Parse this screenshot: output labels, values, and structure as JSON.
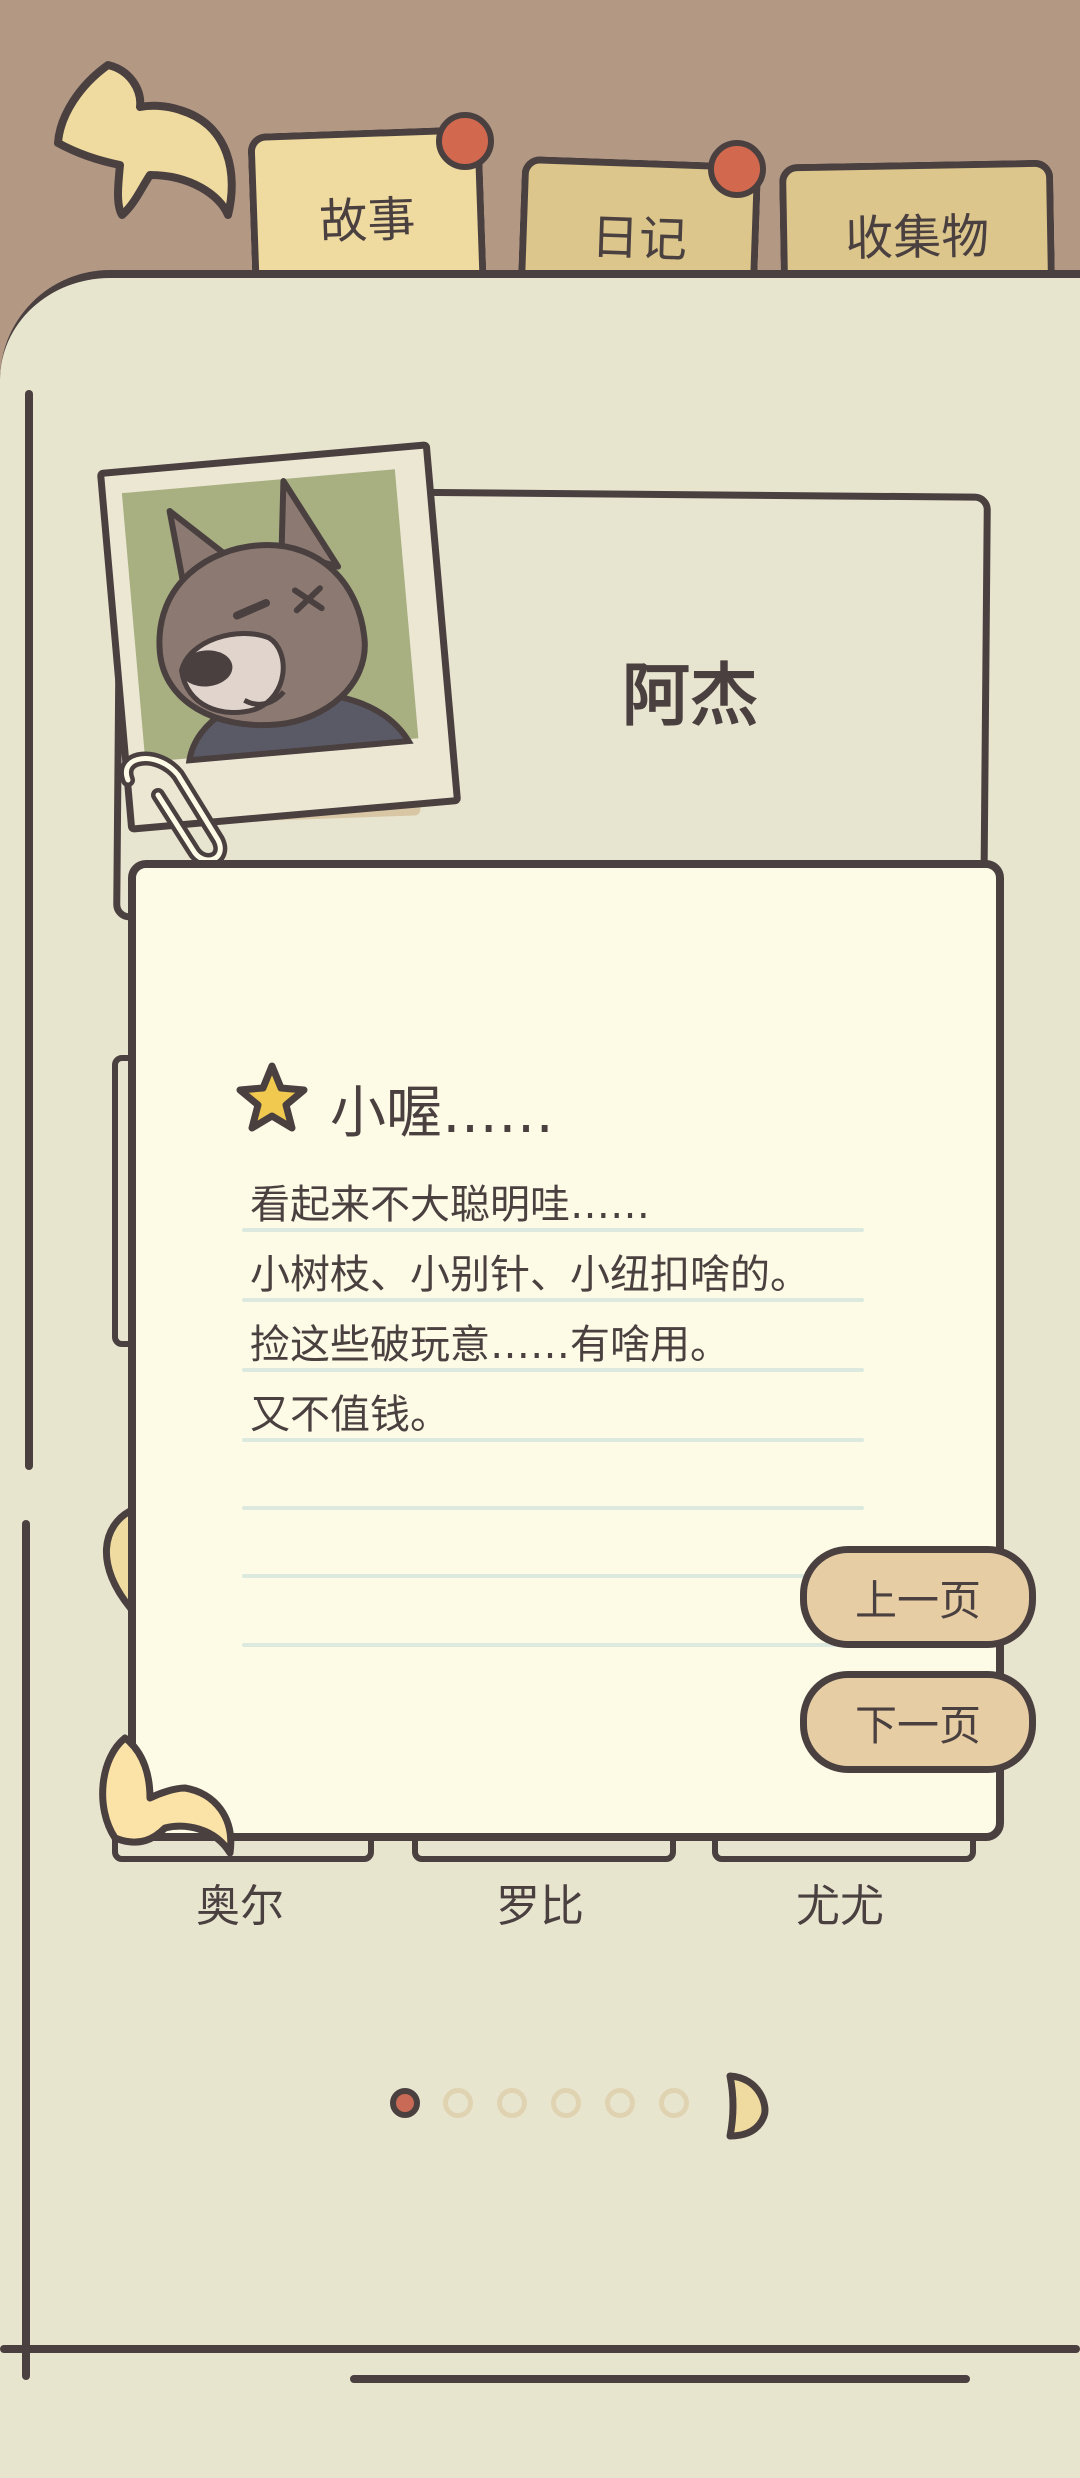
{
  "tabs": [
    {
      "label": "故事",
      "active": true,
      "badge": true
    },
    {
      "label": "日记",
      "active": false,
      "badge": true
    },
    {
      "label": "收集物",
      "active": false,
      "badge": false
    }
  ],
  "character": {
    "name": "阿杰"
  },
  "note": {
    "title": "小喔……",
    "lines": [
      "看起来不大聪明哇……",
      "小树枝、小别针、小纽扣啥的。",
      "捡这些破玩意……有啥用。",
      "又不值钱。"
    ]
  },
  "page_buttons": {
    "prev": "上一页",
    "next": "下一页"
  },
  "sub_characters": [
    "奥尔",
    "罗比",
    "尤尤"
  ],
  "pagination": {
    "current": 1,
    "total": 6
  },
  "colors": {
    "background_top": "#b39884",
    "page": "#e8e5cf",
    "note": "#fdfbe6",
    "outline": "#4a4040",
    "tab_active": "#efdba0",
    "tab_inactive": "#dcc68c",
    "badge": "#d2694f",
    "button": "#e7cda3"
  },
  "icons": [
    "back-arrow-icon",
    "star-icon",
    "paperclip-icon",
    "page-curl-icon",
    "next-page-icon"
  ]
}
